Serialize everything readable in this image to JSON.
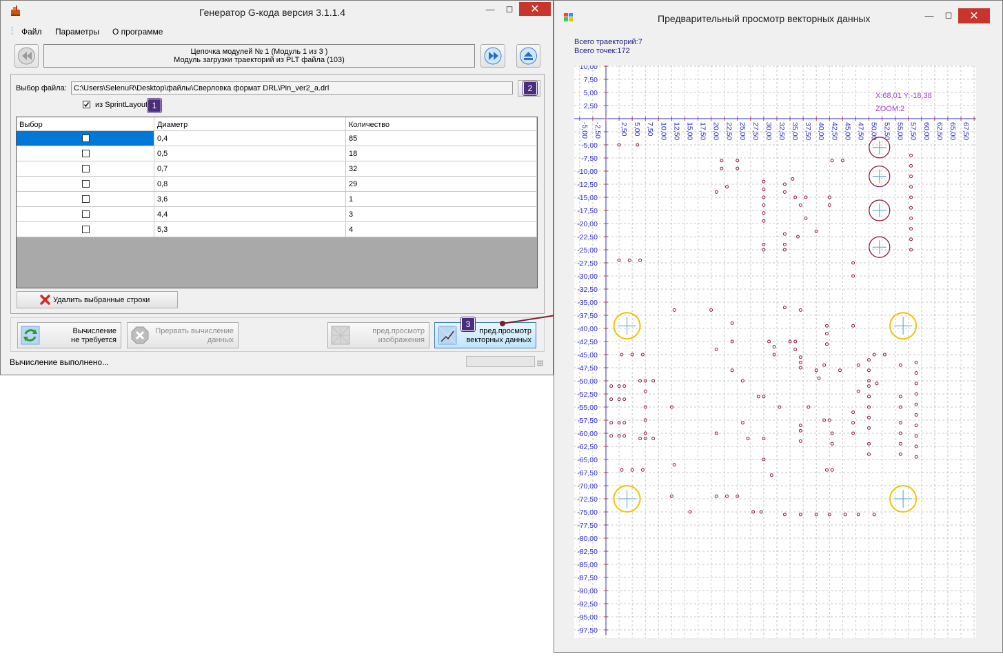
{
  "main_window": {
    "title": "Генератор G-кода версия 3.1.1.4",
    "menu": [
      "Файл",
      "Параметры",
      "О программе"
    ],
    "chain_line1": "Цепочка модулей № 1 (Модуль 1 из 3 )",
    "chain_line2": "Модуль загрузки траекторий из PLT файла (103)",
    "file_label": "Выбор файла:",
    "file_path": "C:\\Users\\SelenuR\\Desktop\\файлы\\Сверловка формат DRL\\Pin_ver2_a.drl",
    "sprint_checkbox_label": "из SprintLayout",
    "sprint_checked": true,
    "table": {
      "headers": [
        "Выбор",
        "Диаметр",
        "Количество"
      ],
      "rows": [
        {
          "diameter": "0,4",
          "count": "85"
        },
        {
          "diameter": "0,5",
          "count": "18"
        },
        {
          "diameter": "0,7",
          "count": "32"
        },
        {
          "diameter": "0,8",
          "count": "29"
        },
        {
          "diameter": "3,6",
          "count": "1"
        },
        {
          "diameter": "4,4",
          "count": "3"
        },
        {
          "diameter": "5,3",
          "count": "4"
        }
      ]
    },
    "delete_button": "Удалить выбранные строки",
    "btn_calc_line1": "Вычисление",
    "btn_calc_line2": "не требуется",
    "btn_abort_line1": "Прервать вычисление",
    "btn_abort_line2": "данных",
    "btn_preview_img_line1": "пред.просмотр",
    "btn_preview_img_line2": "изображения",
    "btn_preview_vec_line1": "пред.просмотр",
    "btn_preview_vec_line2": "векторных данных",
    "status": "Вычисление выполнено...",
    "badges": [
      "1",
      "2",
      "3"
    ]
  },
  "preview_window": {
    "title": "Предварительный просмотр векторных данных",
    "total_paths": "Всего траекторий:7",
    "total_points": "Всего точек:172",
    "cursor_readout": "X:68,01 Y:-18,38",
    "zoom_readout": "ZOOM:2"
  },
  "chart_data": {
    "type": "scatter",
    "x_ticks": [
      "-5,00",
      "-2,50",
      "2,50",
      "5,00",
      "7,50",
      "10,00",
      "12,50",
      "15,00",
      "17,50",
      "20,00",
      "22,50",
      "25,00",
      "27,50",
      "30,00",
      "32,50",
      "35,00",
      "37,50",
      "40,00",
      "42,50",
      "45,00",
      "47,50",
      "50,00",
      "52,50",
      "55,00",
      "57,50",
      "60,00",
      "62,50",
      "65,00",
      "67,50"
    ],
    "y_ticks": [
      "10,00",
      "7,50",
      "5,00",
      "2,50",
      "-5,00",
      "-7,50",
      "-10,00",
      "-12,50",
      "-15,00",
      "-17,50",
      "-20,00",
      "-22,50",
      "-25,00",
      "-27,50",
      "-30,00",
      "-32,50",
      "-35,00",
      "-37,50",
      "-40,00",
      "-42,50",
      "-45,00",
      "-47,50",
      "-50,00",
      "-52,50",
      "-55,00",
      "-57,50",
      "-60,00",
      "-62,50",
      "-65,00",
      "-67,50",
      "-70,00",
      "-72,50",
      "-75,00",
      "-77,50",
      "-80,00",
      "-82,50",
      "-85,00",
      "-87,50",
      "-90,00",
      "-92,50",
      "-95,00",
      "-97,50"
    ],
    "xlim": [
      -5,
      70
    ],
    "ylim": [
      -100,
      10
    ],
    "grid": true,
    "large_holes_red": [
      [
        52,
        -5.5
      ],
      [
        52,
        -11
      ],
      [
        52,
        -17.5
      ],
      [
        52,
        -24.5
      ]
    ],
    "large_holes_yellow": [
      [
        4,
        -39.5
      ],
      [
        4,
        -72.5
      ],
      [
        56.5,
        -39.5
      ],
      [
        56.5,
        -72.5
      ]
    ],
    "points": [
      [
        2.5,
        -27
      ],
      [
        4.5,
        -27
      ],
      [
        6.5,
        -27
      ],
      [
        2.5,
        -5
      ],
      [
        6,
        -5
      ],
      [
        22,
        -8
      ],
      [
        22,
        -9.5
      ],
      [
        25,
        -8
      ],
      [
        25,
        -9.5
      ],
      [
        21,
        -14
      ],
      [
        23,
        -13
      ],
      [
        30,
        -12
      ],
      [
        30,
        -13.5
      ],
      [
        30,
        -15
      ],
      [
        30,
        -16.5
      ],
      [
        30,
        -18
      ],
      [
        30,
        -19.5
      ],
      [
        30,
        -24
      ],
      [
        30,
        -25
      ],
      [
        34,
        -12.5
      ],
      [
        34,
        -14
      ],
      [
        35.5,
        -11.5
      ],
      [
        36,
        -15
      ],
      [
        37,
        -16.5
      ],
      [
        38,
        -15
      ],
      [
        38,
        -19
      ],
      [
        34,
        -22
      ],
      [
        34,
        -24
      ],
      [
        34,
        -25
      ],
      [
        36.5,
        -22.5
      ],
      [
        40,
        -21.5
      ],
      [
        42.5,
        -15
      ],
      [
        42.5,
        -16.5
      ],
      [
        43,
        -8
      ],
      [
        45,
        -8
      ],
      [
        47,
        -27.5
      ],
      [
        47,
        -30
      ],
      [
        58,
        -7
      ],
      [
        58,
        -9
      ],
      [
        58,
        -11
      ],
      [
        58,
        -13
      ],
      [
        58,
        -15
      ],
      [
        58,
        -17
      ],
      [
        58,
        -19
      ],
      [
        58,
        -21
      ],
      [
        58,
        -23
      ],
      [
        58,
        -25
      ],
      [
        3,
        -45
      ],
      [
        5,
        -45
      ],
      [
        7,
        -45
      ],
      [
        1,
        -51
      ],
      [
        2.5,
        -51
      ],
      [
        3.5,
        -51
      ],
      [
        1,
        -53.5
      ],
      [
        2.5,
        -53.5
      ],
      [
        3.5,
        -53.5
      ],
      [
        1,
        -58
      ],
      [
        2.5,
        -58
      ],
      [
        3.5,
        -58
      ],
      [
        1,
        -60.5
      ],
      [
        2.5,
        -60.5
      ],
      [
        3.5,
        -60.5
      ],
      [
        6.5,
        -50
      ],
      [
        7.5,
        -50
      ],
      [
        9,
        -50
      ],
      [
        7.5,
        -52
      ],
      [
        7.5,
        -55
      ],
      [
        7.5,
        -57.5
      ],
      [
        7.5,
        -60
      ],
      [
        6.5,
        -61
      ],
      [
        7.5,
        -61
      ],
      [
        9,
        -61
      ],
      [
        3,
        -67
      ],
      [
        5,
        -67
      ],
      [
        7,
        -67
      ],
      [
        13,
        -36.5
      ],
      [
        20,
        -36.5
      ],
      [
        12.5,
        -55
      ],
      [
        13,
        -66
      ],
      [
        12.5,
        -72
      ],
      [
        16,
        -75
      ],
      [
        21,
        -44
      ],
      [
        21,
        -60
      ],
      [
        21,
        -72
      ],
      [
        23,
        -72
      ],
      [
        25,
        -72
      ],
      [
        24,
        -39
      ],
      [
        24,
        -42.5
      ],
      [
        24,
        -48
      ],
      [
        26,
        -50
      ],
      [
        26,
        -58
      ],
      [
        27,
        -61
      ],
      [
        28,
        -75
      ],
      [
        29,
        -53
      ],
      [
        30,
        -53
      ],
      [
        30,
        -61
      ],
      [
        30,
        -65
      ],
      [
        29.5,
        -75
      ],
      [
        31.5,
        -68
      ],
      [
        31,
        -42.5
      ],
      [
        32,
        -43.5
      ],
      [
        32,
        -45
      ],
      [
        33,
        -55
      ],
      [
        34,
        -36
      ],
      [
        37,
        -36.5
      ],
      [
        35,
        -42.5
      ],
      [
        36,
        -42.5
      ],
      [
        36,
        -44
      ],
      [
        37,
        -45.5
      ],
      [
        37,
        -46.5
      ],
      [
        37,
        -47.5
      ],
      [
        37,
        -58.5
      ],
      [
        37,
        -59.5
      ],
      [
        37,
        -61.5
      ],
      [
        38.5,
        -55
      ],
      [
        40,
        -48
      ],
      [
        40.5,
        -49.5
      ],
      [
        41.5,
        -47
      ],
      [
        41.5,
        -57.5
      ],
      [
        42.5,
        -57.5
      ],
      [
        43,
        -60
      ],
      [
        43,
        -62
      ],
      [
        42,
        -67
      ],
      [
        43,
        -67
      ],
      [
        44.5,
        -48
      ],
      [
        42,
        -39.5
      ],
      [
        42,
        -41
      ],
      [
        42,
        -43
      ],
      [
        47,
        -39.5
      ],
      [
        47,
        -56
      ],
      [
        47,
        -58
      ],
      [
        47,
        -60
      ],
      [
        48,
        -47
      ],
      [
        48,
        -52
      ],
      [
        50,
        -46
      ],
      [
        50,
        -48
      ],
      [
        50,
        -50
      ],
      [
        50,
        -51
      ],
      [
        50,
        -53
      ],
      [
        50,
        -55
      ],
      [
        50,
        -57
      ],
      [
        50,
        -59
      ],
      [
        50,
        -62
      ],
      [
        50,
        -64
      ],
      [
        51.5,
        -50.5
      ],
      [
        51,
        -45
      ],
      [
        53,
        -45
      ],
      [
        56,
        -47
      ],
      [
        56,
        -53
      ],
      [
        56,
        -55
      ],
      [
        56,
        -58
      ],
      [
        56,
        -60
      ],
      [
        56,
        -62
      ],
      [
        56,
        -64
      ],
      [
        59,
        -46.5
      ],
      [
        59,
        -48.5
      ],
      [
        59,
        -50.5
      ],
      [
        59,
        -52.5
      ],
      [
        59,
        -54.5
      ],
      [
        59,
        -56.5
      ],
      [
        59,
        -58.5
      ],
      [
        59,
        -60.5
      ],
      [
        59,
        -62.5
      ],
      [
        59,
        -64.5
      ],
      [
        34,
        -75.5
      ],
      [
        37,
        -75.5
      ],
      [
        40,
        -75.5
      ],
      [
        42.5,
        -75.5
      ],
      [
        45.5,
        -75.5
      ],
      [
        48,
        -75.5
      ],
      [
        51,
        -75.5
      ]
    ]
  }
}
